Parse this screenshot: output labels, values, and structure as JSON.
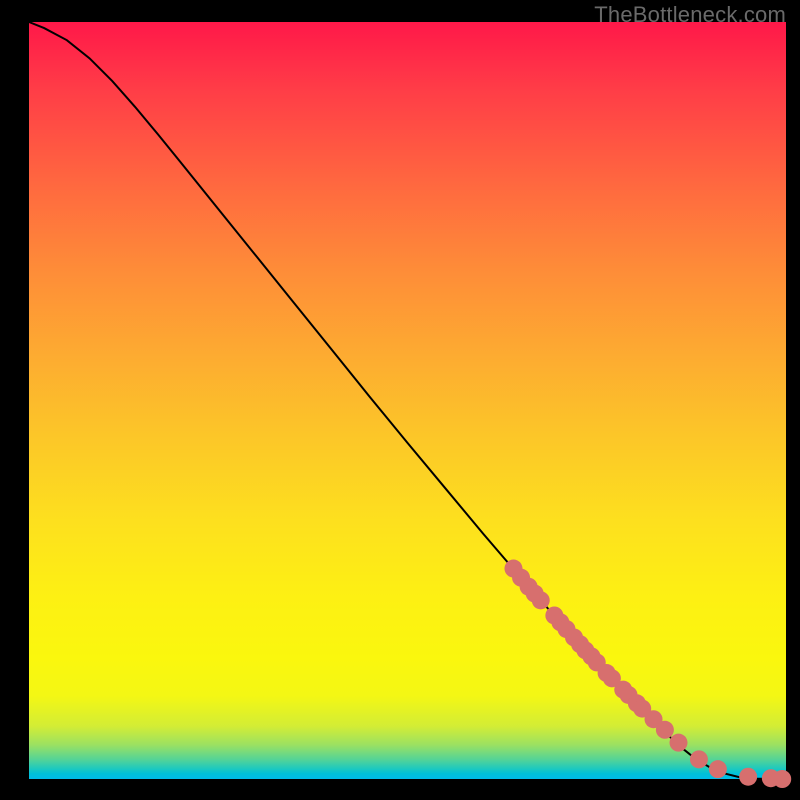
{
  "watermark": "TheBottleneck.com",
  "chart_data": {
    "type": "line",
    "title": "",
    "xlabel": "",
    "ylabel": "",
    "xlim": [
      0,
      100
    ],
    "ylim": [
      0,
      100
    ],
    "grid": false,
    "legend": false,
    "curve": {
      "x": [
        0,
        2,
        5,
        8,
        11,
        14,
        17,
        20,
        25,
        30,
        35,
        40,
        45,
        50,
        55,
        60,
        63,
        66,
        70,
        74,
        78,
        82,
        86,
        88,
        90,
        92,
        94,
        96,
        98,
        100
      ],
      "y": [
        100,
        99.2,
        97.6,
        95.2,
        92.2,
        88.8,
        85.2,
        81.5,
        75.3,
        69.1,
        62.9,
        56.7,
        50.5,
        44.4,
        38.4,
        32.4,
        28.9,
        25.4,
        20.9,
        16.5,
        12.2,
        8.1,
        4.3,
        2.7,
        1.5,
        0.7,
        0.2,
        0.05,
        0.02,
        0.0
      ]
    },
    "points": {
      "x": [
        64,
        65,
        66,
        66.8,
        67.6,
        69.4,
        70.2,
        71,
        72,
        72.8,
        73.5,
        74.3,
        75,
        76.3,
        77,
        78.5,
        79.2,
        80.3,
        81,
        82.5,
        84,
        85.8,
        88.5,
        91,
        95,
        98,
        99.5
      ],
      "y": [
        27.8,
        26.6,
        25.4,
        24.5,
        23.6,
        21.6,
        20.7,
        19.8,
        18.7,
        17.8,
        17.0,
        16.2,
        15.4,
        14.0,
        13.3,
        11.8,
        11.1,
        10.0,
        9.3,
        7.9,
        6.5,
        4.8,
        2.6,
        1.3,
        0.3,
        0.1,
        0.0
      ]
    },
    "colors": {
      "line": "#000000",
      "points": "#d76f6e"
    }
  }
}
